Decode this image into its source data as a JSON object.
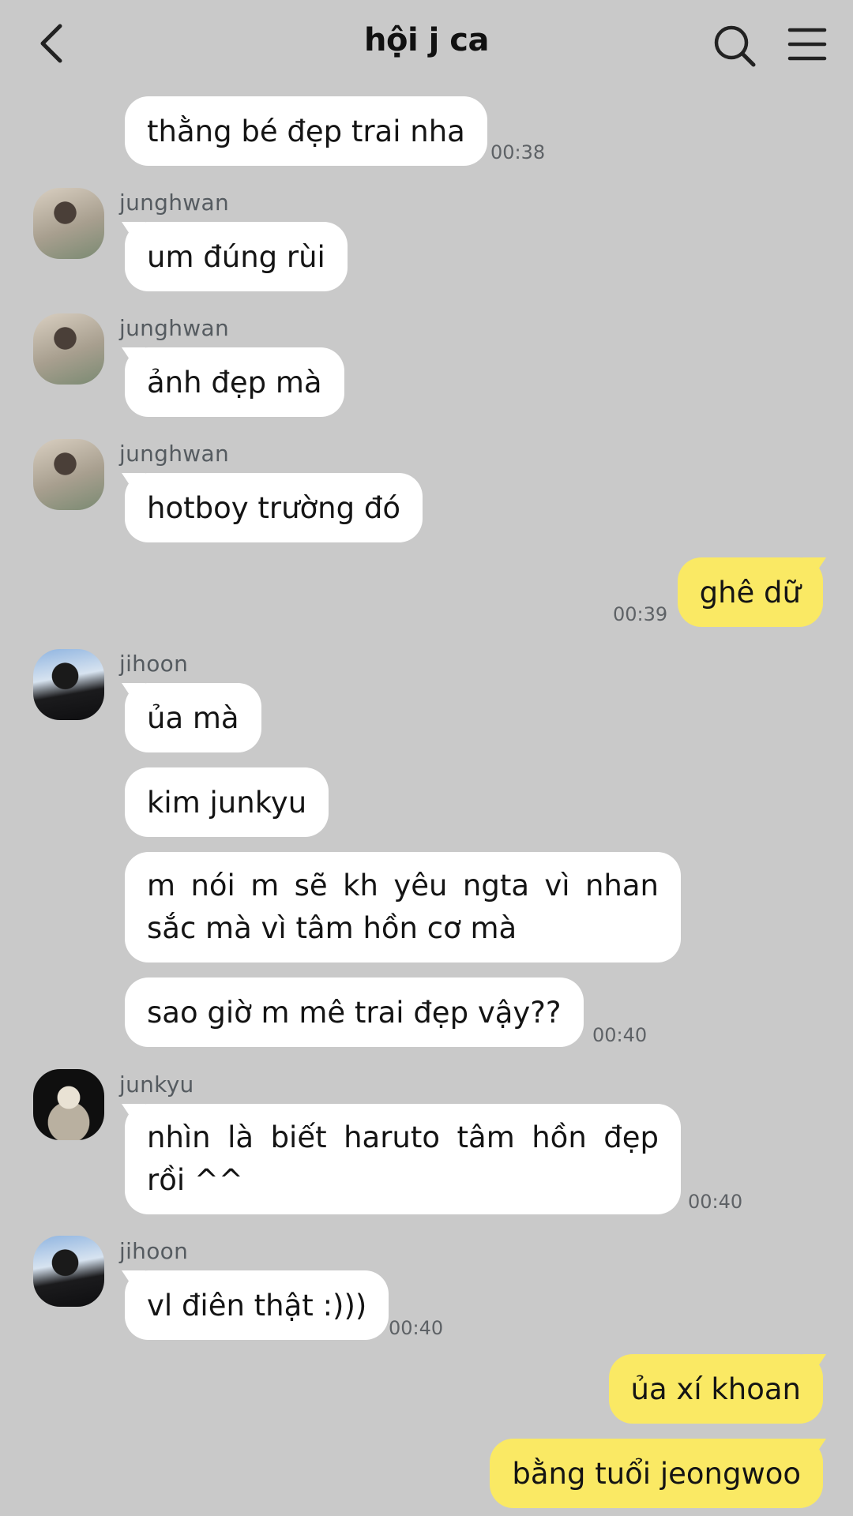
{
  "header": {
    "title": "hội j ca"
  },
  "messages": [
    {
      "text": "thằng bé đẹp trai nha",
      "time": "00:38"
    },
    {
      "sender": "junghwan",
      "text": "um đúng rùi"
    },
    {
      "sender": "junghwan",
      "text": "ảnh đẹp mà"
    },
    {
      "sender": "junghwan",
      "text": "hotboy trường đó"
    },
    {
      "text": "ghê dữ",
      "time": "00:39",
      "mine": true
    },
    {
      "sender": "jihoon",
      "text": "ủa mà"
    },
    {
      "text": "kim junkyu"
    },
    {
      "text": "m nói m sẽ kh yêu ngta vì nhan sắc mà vì tâm hồn cơ mà"
    },
    {
      "text": "sao giờ m mê trai đẹp vậy??",
      "time": "00:40"
    },
    {
      "sender": "junkyu",
      "text": "nhìn là biết haruto tâm hồn đẹp rồi ^^",
      "time": "00:40"
    },
    {
      "sender": "jihoon",
      "text": "vl điên thật :)))",
      "time": "00:40"
    },
    {
      "text": "ủa xí khoan",
      "mine": true
    },
    {
      "text": "bằng tuổi jeongwoo",
      "mine": true
    }
  ],
  "colors": {
    "background": "#c9c9c9",
    "bubble_incoming": "#ffffff",
    "bubble_outgoing": "#fae964"
  },
  "icons": {
    "back": "chevron-left-icon",
    "search": "search-icon",
    "menu": "hamburger-menu-icon"
  }
}
